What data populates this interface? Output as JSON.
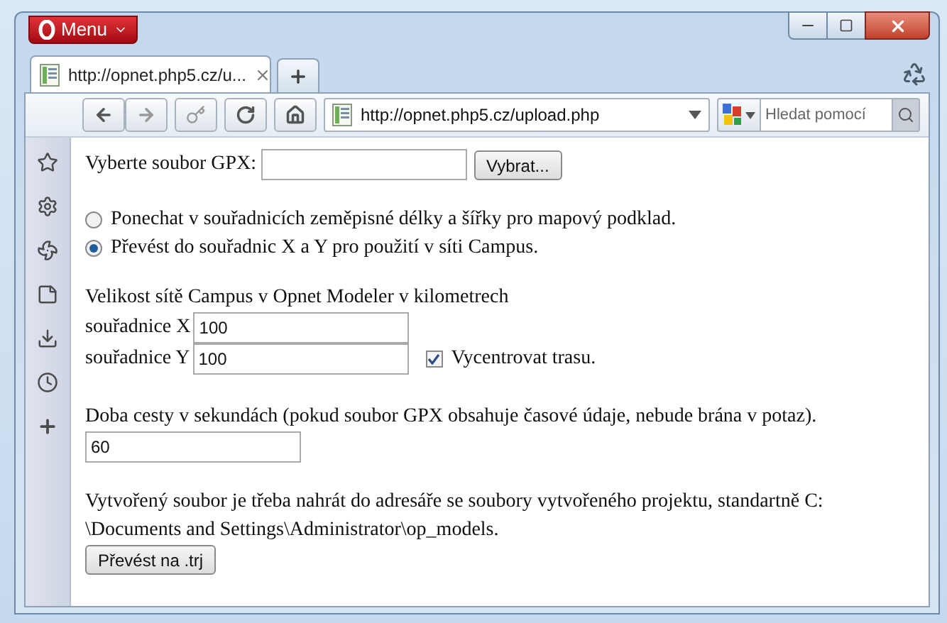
{
  "window": {
    "menu_label": "Menu"
  },
  "tabs": [
    {
      "title": "http://opnet.php5.cz/u...",
      "selected": true
    }
  ],
  "toolbar": {
    "url": "http://opnet.php5.cz/upload.php",
    "search_placeholder": "Hledat pomocí"
  },
  "page": {
    "file_label": "Vyberte soubor GPX:",
    "browse_button": "Vybrat...",
    "radios": [
      {
        "label": "Ponechat v souřadnicích zeměpisné délky a šířky pro mapový podklad.",
        "selected": false
      },
      {
        "label": "Převést do souřadnic X a Y pro použití v síti Campus.",
        "selected": true
      }
    ],
    "size_heading": "Velikost sítě Campus v Opnet Modeler v kilometrech",
    "fields": [
      {
        "label": "souřadnice X",
        "value": "100"
      },
      {
        "label": "souřadnice Y",
        "value": "100"
      }
    ],
    "center_checkbox": {
      "label": "Vycentrovat trasu.",
      "checked": true
    },
    "duration_label": "Doba cesty v sekundách (pokud soubor GPX obsahuje časové údaje, nebude brána v potaz).",
    "duration_value": "60",
    "note_lines": [
      "Vytvořený soubor je třeba nahrát do adresáře se soubory vytvořeného projektu, standartně C:",
      "\\Documents and Settings\\Administrator\\op_models."
    ],
    "convert_button": "Převést na .trj"
  }
}
